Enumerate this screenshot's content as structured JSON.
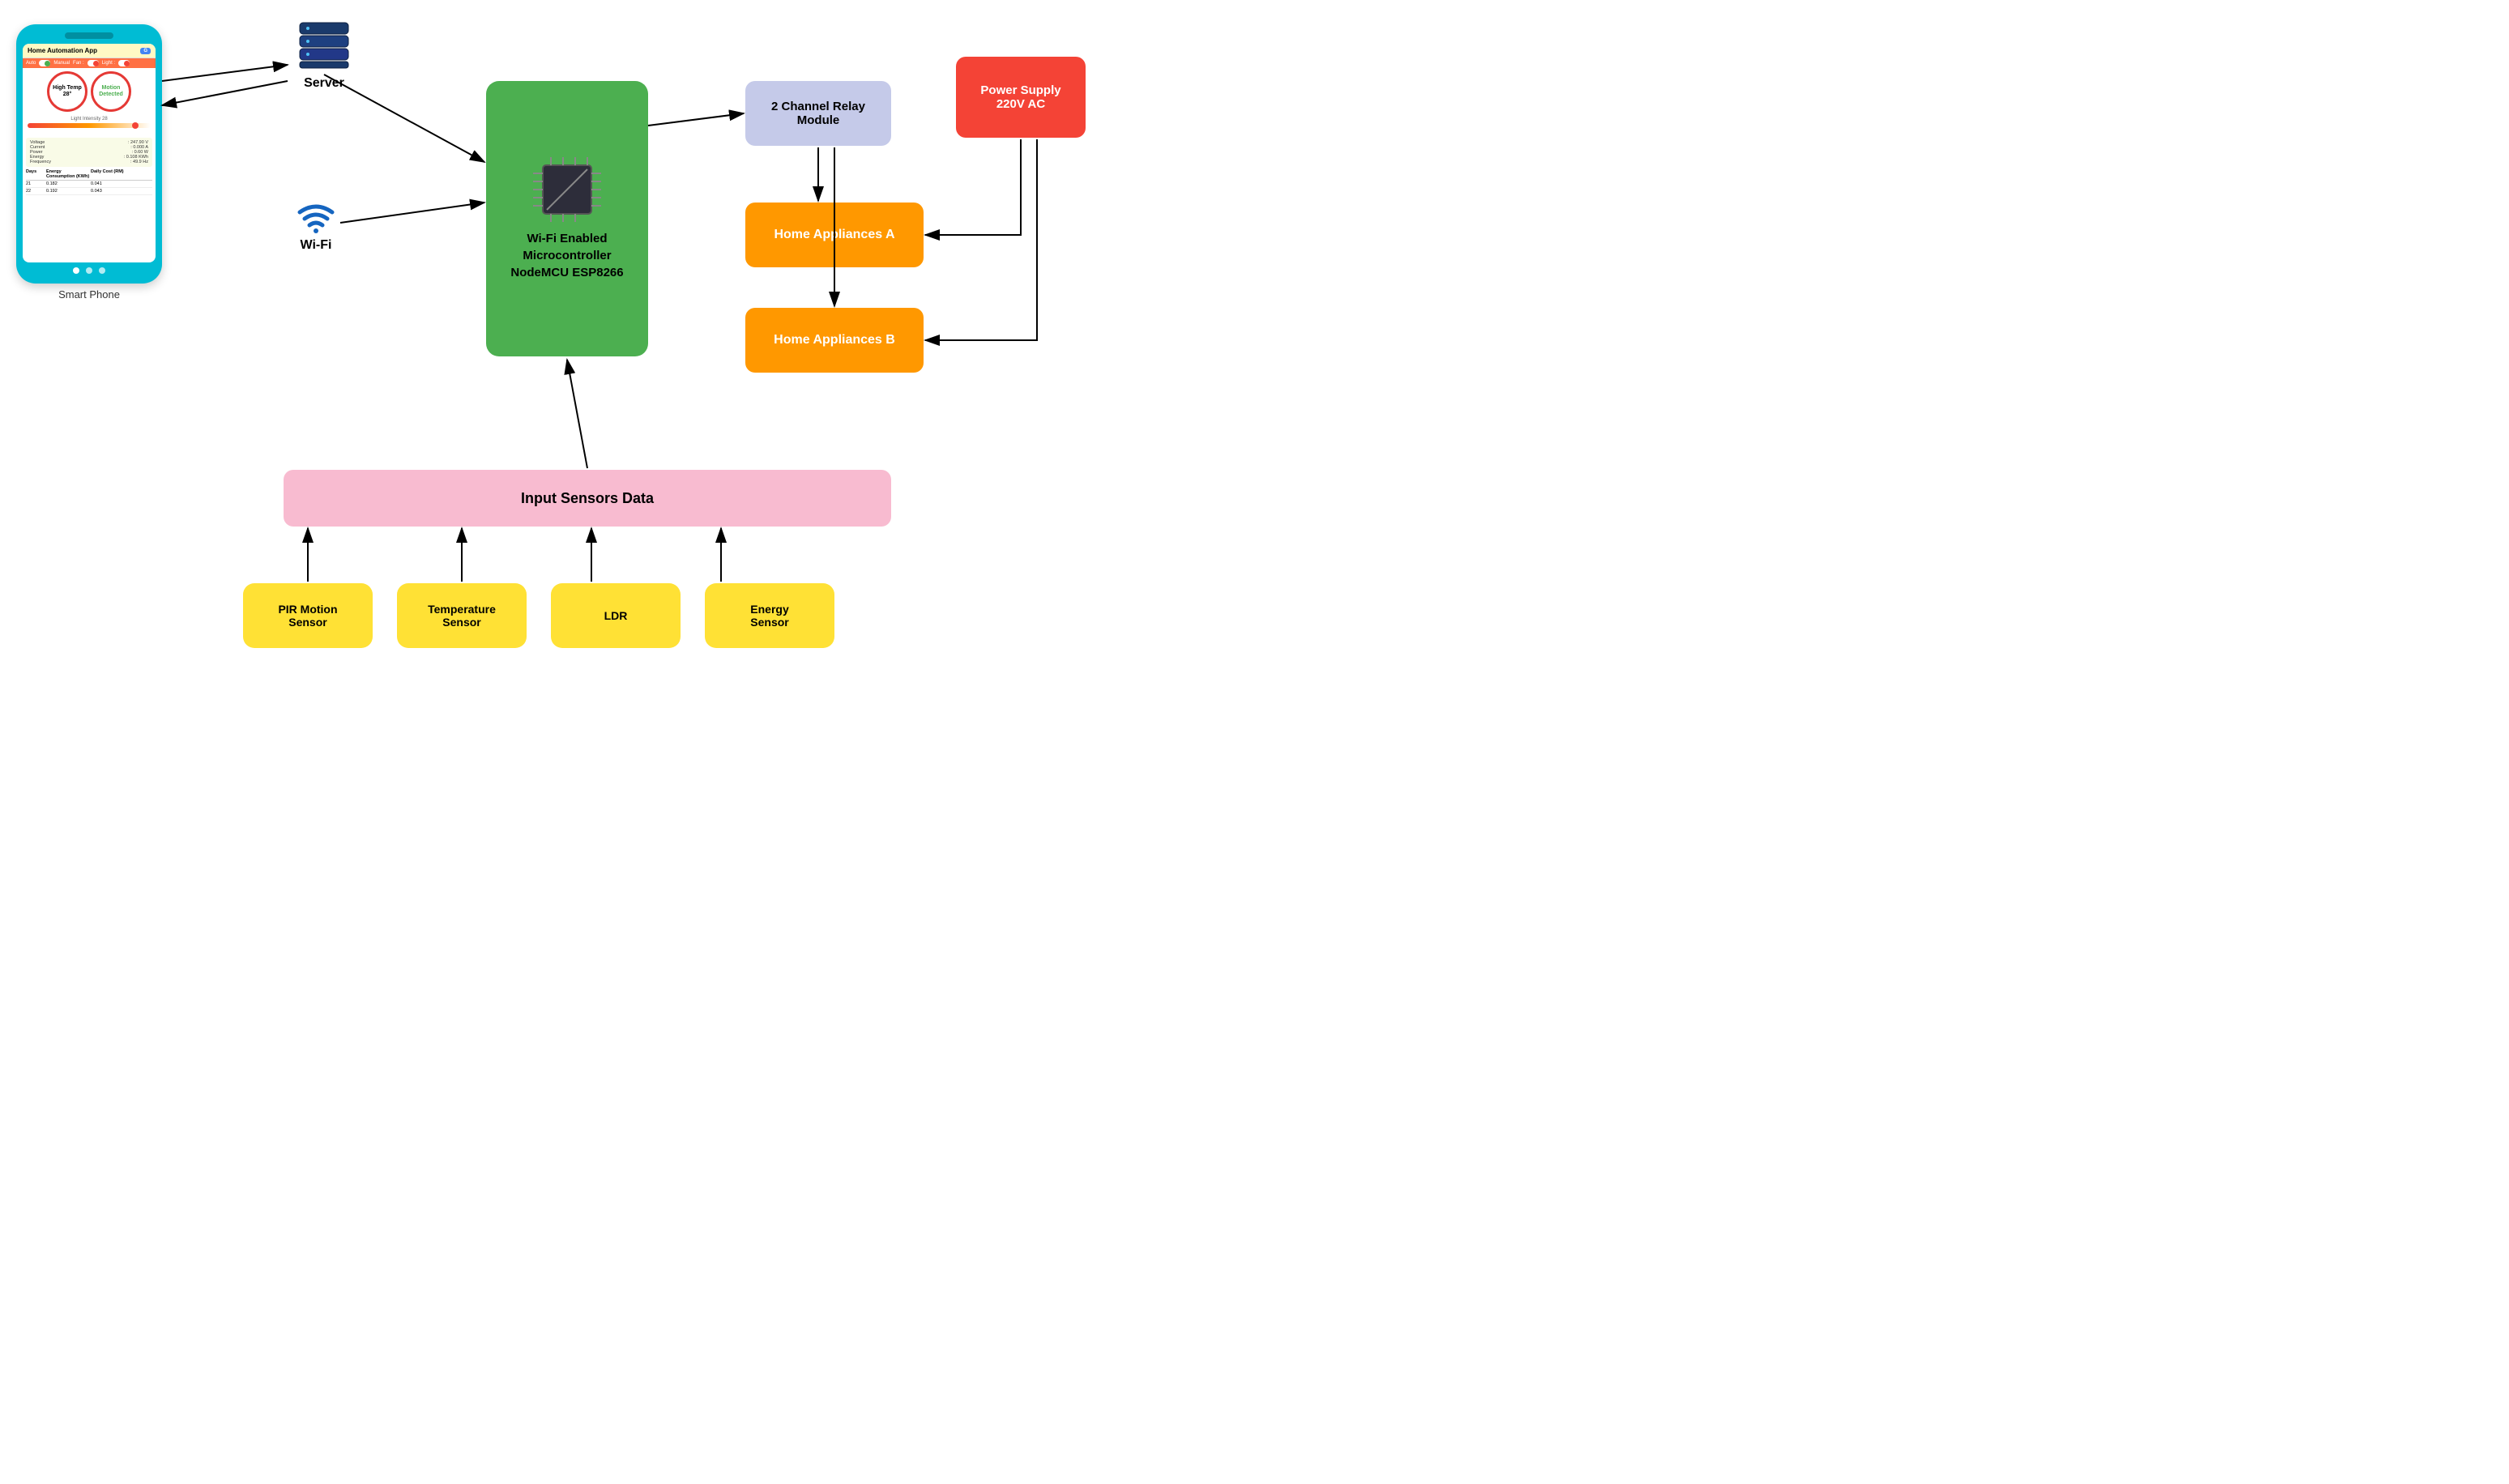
{
  "phone": {
    "title": "Home Automation App",
    "google_btn": "G",
    "controls": {
      "auto_label": "Auto",
      "manual_label": "Manual",
      "fan_label": "Fan :",
      "light_label": "Light :"
    },
    "high_temp": "High Temp\n28°",
    "high_temp_line1": "High Temp",
    "high_temp_line2": "28°",
    "motion_label": "Motion\nDetected",
    "light_intensity_label": "Light Intensity 28",
    "data_rows": [
      {
        "label": "Voltage",
        "value": ": 247.90 V"
      },
      {
        "label": "Current",
        "value": ": 0.000 A"
      },
      {
        "label": "Power",
        "value": ": 0.60 W"
      },
      {
        "label": "Energy",
        "value": ": 0.108 KWh"
      },
      {
        "label": "Frequency",
        "value": ": 49.9 Hz"
      }
    ],
    "table_headers": [
      "Days",
      "Energy Consumption (KWh)",
      "Daily Cost (RM)"
    ],
    "table_rows": [
      [
        "21",
        "0.182",
        "0.041"
      ],
      [
        "22",
        "0.192",
        "0.043"
      ]
    ],
    "label": "Smart Phone"
  },
  "server": {
    "label": "Server"
  },
  "wifi": {
    "label": "Wi-Fi"
  },
  "mcu": {
    "line1": "Wi-Fi Enabled",
    "line2": "Microcontroller",
    "line3": "NodeMCU ESP8266"
  },
  "relay": {
    "label": "2 Channel Relay Module"
  },
  "power": {
    "line1": "Power Supply",
    "line2": "220V AC"
  },
  "appliance_a": {
    "label": "Home Appliances A"
  },
  "appliance_b": {
    "label": "Home Appliances B"
  },
  "input_sensors": {
    "label": "Input Sensors Data"
  },
  "sensors": [
    {
      "label": "PIR Motion Sensor"
    },
    {
      "label": "Temperature Sensor"
    },
    {
      "label": "LDR"
    },
    {
      "label": "Energy Sensor"
    }
  ]
}
